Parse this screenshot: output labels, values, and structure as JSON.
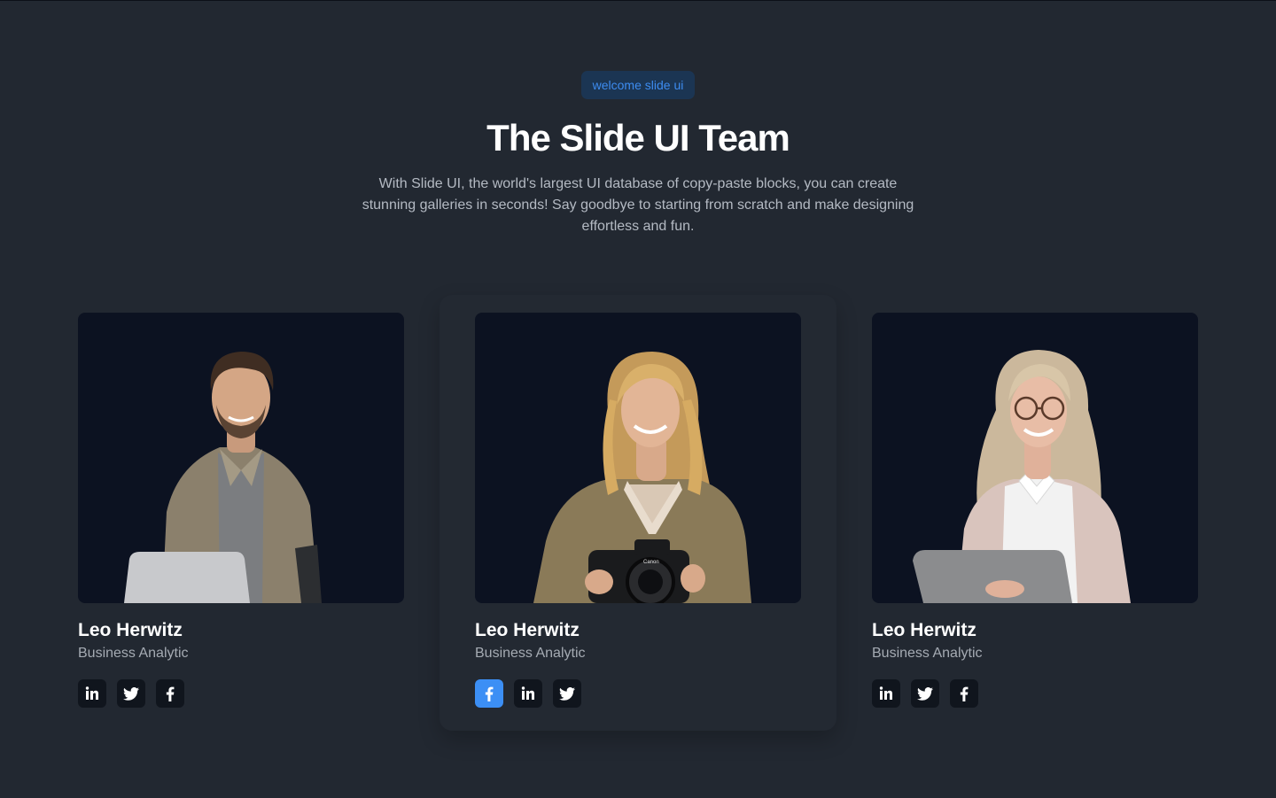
{
  "header": {
    "badge": "welcome slide ui",
    "title": "The Slide UI Team",
    "subtitle": "With Slide UI, the world's largest UI database of copy-paste blocks, you can create stunning galleries in seconds! Say goodbye to starting from scratch and make designing effortless and fun."
  },
  "team": [
    {
      "name": "Leo Herwitz",
      "role": "Business Analytic",
      "photo": "man-with-laptop",
      "socials": [
        "linkedin-icon",
        "twitter-icon",
        "facebook-icon"
      ]
    },
    {
      "name": "Leo Herwitz",
      "role": "Business Analytic",
      "photo": "woman-with-camera",
      "socials": [
        "facebook-icon",
        "linkedin-icon",
        "twitter-icon"
      ]
    },
    {
      "name": "Leo Herwitz",
      "role": "Business Analytic",
      "photo": "woman-with-glasses-and-tablet",
      "socials": [
        "linkedin-icon",
        "twitter-icon",
        "facebook-icon"
      ]
    }
  ],
  "colors": {
    "background": "#222831",
    "badge_bg": "#1b3553",
    "badge_text": "#3d8cf0",
    "accent": "#3c8ff5",
    "photo_bg": "#0c1221"
  }
}
